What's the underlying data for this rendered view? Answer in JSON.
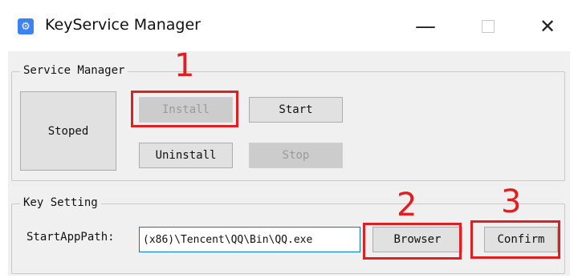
{
  "window": {
    "title": "KeyService Manager",
    "icon": "gear-icon",
    "controls": {
      "minimize": "—",
      "maximize": "",
      "close": "✕"
    }
  },
  "service_manager": {
    "group_label": "Service Manager",
    "status": "Stoped",
    "install_label": "Install",
    "start_label": "Start",
    "uninstall_label": "Uninstall",
    "stop_label": "Stop"
  },
  "key_setting": {
    "group_label": "Key Setting",
    "path_label": "StartAppPath:",
    "path_value": "(x86)\\Tencent\\QQ\\Bin\\QQ.exe",
    "browser_label": "Browser",
    "confirm_label": "Confirm"
  },
  "annotations": {
    "step1": "1",
    "step2": "2",
    "step3": "3",
    "color": "#e02020"
  }
}
